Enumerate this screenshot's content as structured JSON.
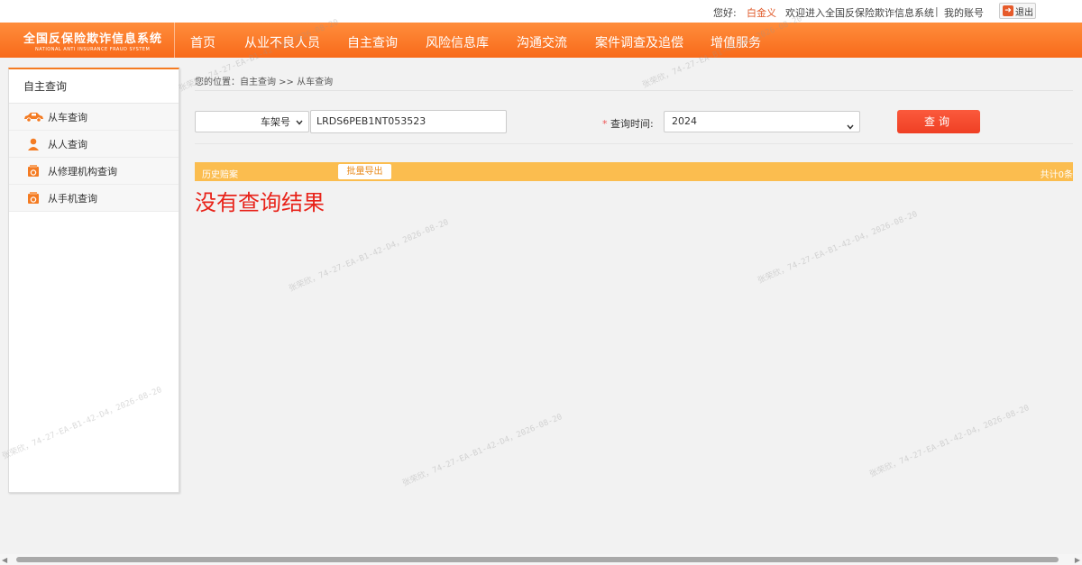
{
  "topbar": {
    "greeting": "您好:",
    "username": "白金义",
    "welcome": "欢迎进入全国反保险欺诈信息系统",
    "separator": "|",
    "my_account": "我的账号",
    "logout": "退出"
  },
  "logo": {
    "cn": "全国反保险欺诈信息系统",
    "en": "NATIONAL ANTI INSURANCE FRAUD SYSTEM"
  },
  "nav": [
    "首页",
    "从业不良人员",
    "自主查询",
    "风险信息库",
    "沟通交流",
    "案件调查及追偿",
    "增值服务"
  ],
  "sidebar": {
    "title": "自主查询",
    "items": [
      {
        "label": "从车查询",
        "icon": "car-icon"
      },
      {
        "label": "从人查询",
        "icon": "person-icon"
      },
      {
        "label": "从修理机构查询",
        "icon": "repair-shop-icon"
      },
      {
        "label": "从手机查询",
        "icon": "phone-icon"
      }
    ]
  },
  "breadcrumb": "您的位置：自主查询 >> 从车查询",
  "form": {
    "type_select": "车架号",
    "vin_value": "LRDS6PEB1NT053523",
    "time_label": "查询时间:",
    "time_star": "*",
    "time_select": "2024",
    "query_button": "查询"
  },
  "history": {
    "label": "历史赔案",
    "export_button": "批量导出",
    "total": "共计0条"
  },
  "no_result": "没有查询结果",
  "watermark": "张荣欣，74-27-EA-B1-42-D4，2026-08-20",
  "colors": {
    "accent": "#f86a1a",
    "history_bar": "#fbbd4f",
    "no_result": "#e8231a",
    "query_button": "#ef3f24"
  }
}
